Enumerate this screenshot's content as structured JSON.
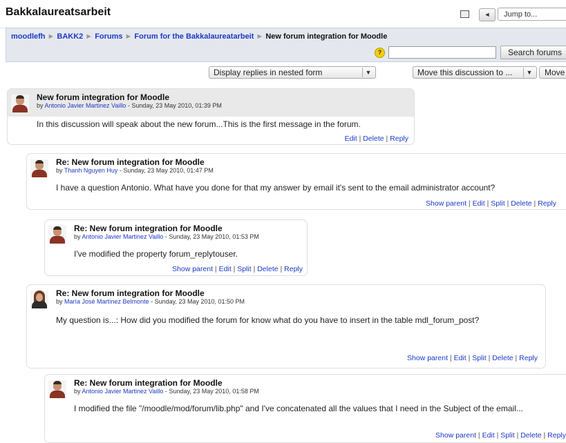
{
  "header": {
    "site_title": "Bakkalaureatsarbeit",
    "jump_to": "Jump to..."
  },
  "breadcrumb": {
    "items": [
      "moodlefh",
      "BAKK2",
      "Forums",
      "Forum for the Bakkalaureatarbeit"
    ],
    "current": "New forum integration for Moodle"
  },
  "search": {
    "help_glyph": "?",
    "button_label": "Search forums",
    "value": ""
  },
  "controls": {
    "display_mode": "Display replies in nested form",
    "move_select": "Move this discussion to ...",
    "move_button": "Move"
  },
  "posts": [
    {
      "title": "New forum integration for Moodle",
      "author": "Antonio Javier Martinez Vaillo",
      "date": "- Sunday, 23 May 2010, 01:39 PM",
      "message": "In this discussion will speak about the new forum...This is the first message in the forum.",
      "commands": [
        "Edit",
        "Delete",
        "Reply"
      ],
      "avatar": "male-avatar"
    },
    {
      "title": "Re: New forum integration for Moodle",
      "author": "Thanh Nguyen Huy",
      "date": "- Sunday, 23 May 2010, 01:47 PM",
      "message": "I have a question Antonio. What have you done for that my answer by email it's sent to the email administrator account?",
      "commands": [
        "Show parent",
        "Edit",
        "Split",
        "Delete",
        "Reply"
      ],
      "avatar": "male-avatar"
    },
    {
      "title": "Re: New forum integration for Moodle",
      "author": "Antonio Javier Martinez Vaillo",
      "date": "- Sunday, 23 May 2010, 01:53 PM",
      "message": "I've modified the property forum_replytouser.",
      "commands": [
        "Show parent",
        "Edit",
        "Split",
        "Delete",
        "Reply"
      ],
      "avatar": "male-avatar"
    },
    {
      "title": "Re: New forum integration for Moodle",
      "author": "María José Martínez Belmonte",
      "date": "- Sunday, 23 May 2010, 01:50 PM",
      "message": "My question is...: How did you modified the forum for know what do you have to insert in the table mdl_forum_post?",
      "commands": [
        "Show parent",
        "Edit",
        "Split",
        "Delete",
        "Reply"
      ],
      "avatar": "female-avatar"
    },
    {
      "title": "Re: New forum integration for Moodle",
      "author": "Antonio Javier Martinez Vaillo",
      "date": "- Sunday, 23 May 2010, 01:58 PM",
      "message": "I modified the file \"/moodle/mod/forum/lib.php\" and I've concatenated all the values that I need in the Subject of the email...",
      "commands": [
        "Show parent",
        "Edit",
        "Split",
        "Delete",
        "Reply"
      ],
      "avatar": "male-avatar"
    }
  ]
}
